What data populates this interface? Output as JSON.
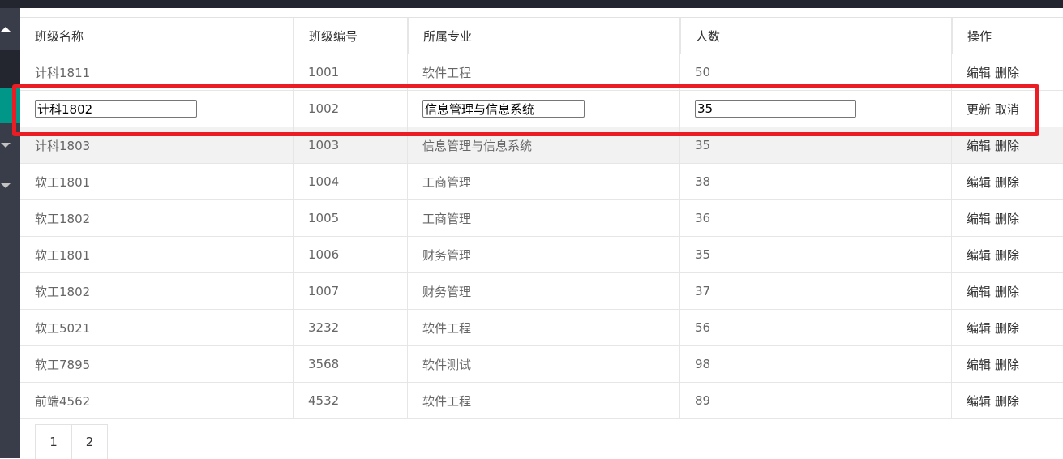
{
  "table": {
    "headers": [
      "班级名称",
      "班级编号",
      "所属专业",
      "人数",
      "操作"
    ],
    "rows": [
      {
        "name": "计科1811",
        "code": "1001",
        "major": "软件工程",
        "count": "50",
        "op1": "编辑",
        "op2": "删除"
      },
      {
        "name": "计科1802",
        "code": "1002",
        "major": "信息管理与信息系统",
        "count": "35",
        "op1": "更新",
        "op2": "取消"
      },
      {
        "name": "计科1803",
        "code": "1003",
        "major": "信息管理与信息系统",
        "count": "35",
        "op1": "编辑",
        "op2": "删除"
      },
      {
        "name": "软工1801",
        "code": "1004",
        "major": "工商管理",
        "count": "38",
        "op1": "编辑",
        "op2": "删除"
      },
      {
        "name": "软工1802",
        "code": "1005",
        "major": "工商管理",
        "count": "36",
        "op1": "编辑",
        "op2": "删除"
      },
      {
        "name": "软工1801",
        "code": "1006",
        "major": "财务管理",
        "count": "35",
        "op1": "编辑",
        "op2": "删除"
      },
      {
        "name": "软工1802",
        "code": "1007",
        "major": "财务管理",
        "count": "37",
        "op1": "编辑",
        "op2": "删除"
      },
      {
        "name": "软工5021",
        "code": "3232",
        "major": "软件工程",
        "count": "56",
        "op1": "编辑",
        "op2": "删除"
      },
      {
        "name": "软工7895",
        "code": "3568",
        "major": "软件测试",
        "count": "98",
        "op1": "编辑",
        "op2": "删除"
      },
      {
        "name": "前端4562",
        "code": "4532",
        "major": "软件工程",
        "count": "89",
        "op1": "编辑",
        "op2": "删除"
      }
    ]
  },
  "pagination": {
    "pages": [
      "1",
      "2"
    ]
  },
  "colors": {
    "highlight": "#ea1c24",
    "active_nav": "#009688",
    "sidebar": "#393d49"
  }
}
